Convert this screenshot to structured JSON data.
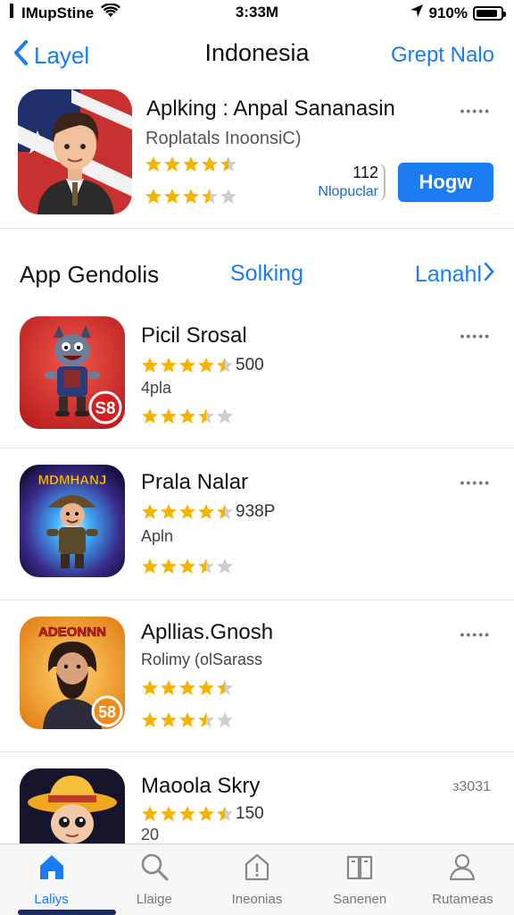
{
  "status_bar": {
    "carrier": "IMupStine",
    "time": "3:33M",
    "battery": "910%",
    "battery_level": 0.9
  },
  "nav": {
    "back_label": "Layel",
    "title": "Indonesia",
    "right_label": "Grept Nalo"
  },
  "featured": {
    "name": "Aplking : Anpal Sananasin",
    "subtitle": "Roplatals InoonsiC)",
    "rating_top": 4.5,
    "rating_bottom": 3.5,
    "rank_number": "112",
    "rank_label": "Nlopuclar",
    "get_label": "Hogw",
    "more": "•••••"
  },
  "section": {
    "title": "App Gendolis",
    "middle_link": "Solking",
    "right_link": "Lanahl"
  },
  "apps": [
    {
      "name": "Picil Srosal",
      "rating": 4.5,
      "count": "500",
      "sub": "4pla",
      "rating2": 3.5,
      "more": "•••••",
      "badge": "S8"
    },
    {
      "name": "Prala Nalar",
      "rating": 4.5,
      "count": "938P",
      "sub": "Apln",
      "rating2": 3.5,
      "more": "•••••",
      "banner": "MDMHANJ"
    },
    {
      "name": "Apllias.Gnosh",
      "rating": 4.5,
      "count": "",
      "sub": "Rolimy (olSarass",
      "rating2": 3.5,
      "more": "•••••",
      "banner": "ADEONNN",
      "badge": "58"
    },
    {
      "name": "Maoola Skry",
      "rating": 4.5,
      "count": "150",
      "sub": "20",
      "rating2": 0,
      "more": "з3031"
    }
  ],
  "tabs": [
    {
      "label": "Laliys",
      "icon": "home-icon",
      "active": true
    },
    {
      "label": "Llaige",
      "icon": "search-icon",
      "active": false
    },
    {
      "label": "Ineonias",
      "icon": "alert-house-icon",
      "active": false
    },
    {
      "label": "Sanenen",
      "icon": "book-icon",
      "active": false
    },
    {
      "label": "Rutameas",
      "icon": "person-icon",
      "active": false
    }
  ],
  "colors": {
    "accent": "#1a7cf0",
    "star": "#f5b400",
    "star_empty": "#cfcfcf"
  }
}
